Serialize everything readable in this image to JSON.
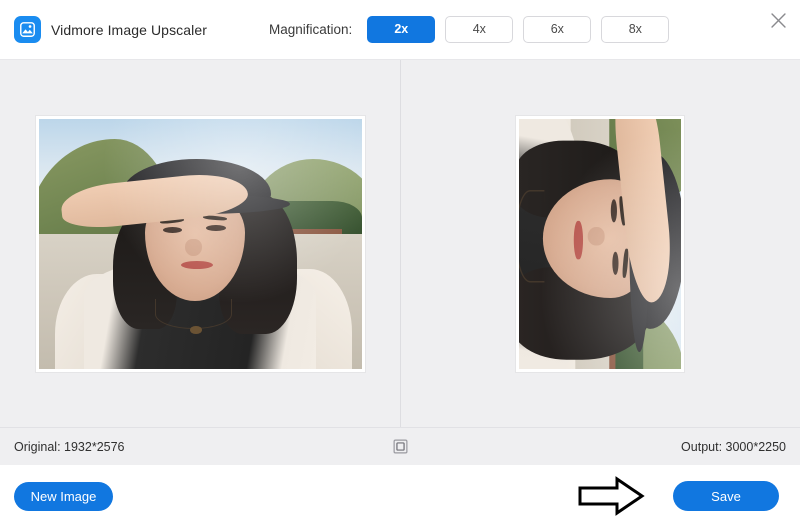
{
  "app": {
    "brand_name": "Vidmore Image Upscaler",
    "logo_icon": "image-resize-icon",
    "accent_color": "#1177e0",
    "background_color": "#efeff1"
  },
  "header": {
    "magnification_label": "Magnification:",
    "magnification_options": [
      {
        "label": "2x",
        "selected": true
      },
      {
        "label": "4x",
        "selected": false
      },
      {
        "label": "6x",
        "selected": false
      },
      {
        "label": "8x",
        "selected": false
      }
    ],
    "close_icon": "close-icon"
  },
  "preview": {
    "left_pane_name": "original-image-preview",
    "right_pane_name": "upscaled-image-preview",
    "photo_description": "Portrait selfie of a woman wearing a dark bucket hat, shading her eyes with her hand, at a beach with green hills and trees in the background"
  },
  "statusbar": {
    "original_label": "Original: 1932*2576",
    "output_label": "Output: 3000*2250",
    "compare_icon": "compare-square-icon"
  },
  "footer": {
    "new_image_label": "New Image",
    "save_label": "Save",
    "annotation_icon": "right-arrow-annotation"
  }
}
